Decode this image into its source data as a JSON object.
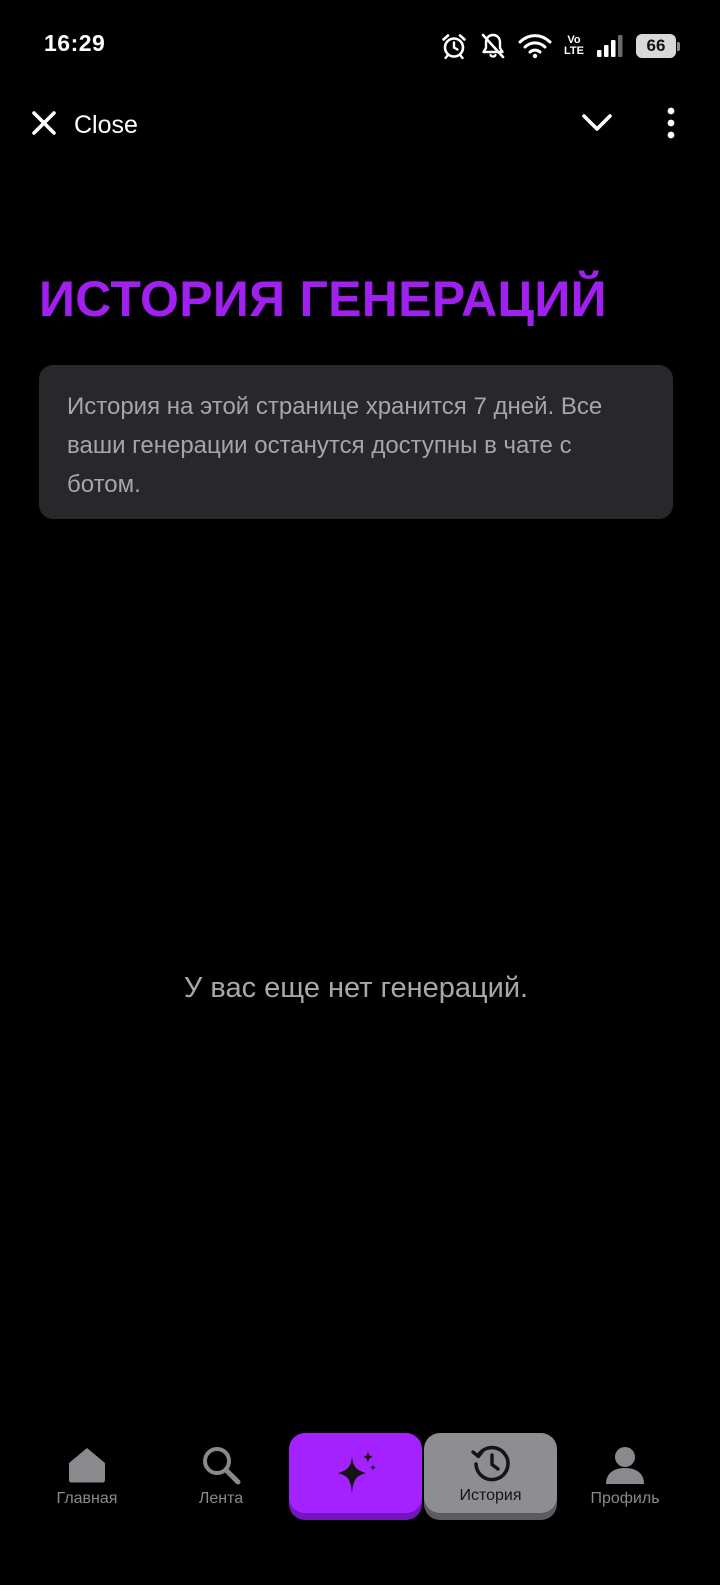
{
  "status_bar": {
    "time": "16:29",
    "icons": [
      "alarm-icon",
      "bell-off-icon",
      "wifi-icon",
      "volte-icon",
      "signal-icon",
      "battery-icon"
    ],
    "volte_top": "Vo",
    "volte_bottom": "LTE",
    "battery_level": "66"
  },
  "header": {
    "close_label": "Close",
    "icons": [
      "close-icon",
      "chevron-down-icon",
      "more-vertical-icon"
    ]
  },
  "main": {
    "title": "ИСТОРИЯ ГЕНЕРАЦИЙ",
    "info_text": "История на этой странице хранится 7 дней. Все ваши генерации останутся доступны в чате с ботом.",
    "empty_text": "У вас еще нет генераций."
  },
  "bottom_nav": {
    "items": [
      {
        "label": "Главная",
        "icon": "home-icon"
      },
      {
        "label": "Лента",
        "icon": "search-icon"
      },
      {
        "label": "",
        "icon": "sparkle-icon"
      },
      {
        "label": "История",
        "icon": "history-icon",
        "active": true
      },
      {
        "label": "Профиль",
        "icon": "user-icon"
      }
    ]
  },
  "colors": {
    "background": "#000000",
    "accent": "#a322ff",
    "title": "#a020f0",
    "card": "#28282a",
    "muted_text": "#a6a6aa",
    "active_tab": "#8e8e92"
  }
}
